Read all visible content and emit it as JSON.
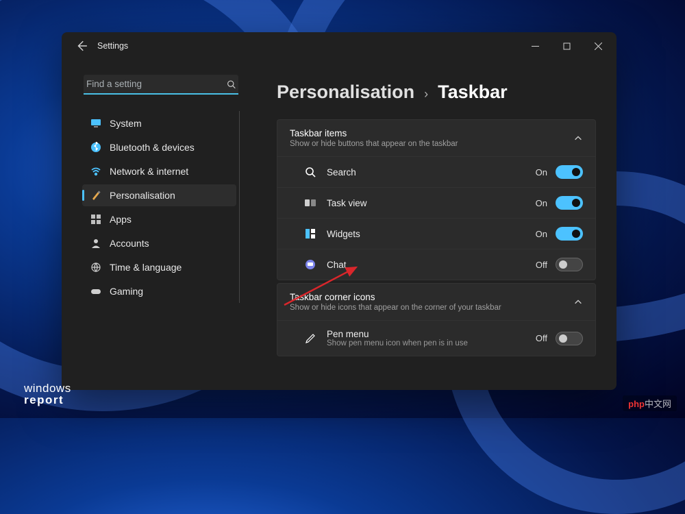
{
  "window": {
    "title": "Settings"
  },
  "search": {
    "placeholder": "Find a setting"
  },
  "sidebar": {
    "items": [
      {
        "label": "System",
        "icon": "monitor",
        "active": false
      },
      {
        "label": "Bluetooth & devices",
        "icon": "bluetooth",
        "active": false
      },
      {
        "label": "Network & internet",
        "icon": "wifi",
        "active": false
      },
      {
        "label": "Personalisation",
        "icon": "paintbrush",
        "active": true
      },
      {
        "label": "Apps",
        "icon": "apps",
        "active": false
      },
      {
        "label": "Accounts",
        "icon": "user",
        "active": false
      },
      {
        "label": "Time & language",
        "icon": "globe-clock",
        "active": false
      },
      {
        "label": "Gaming",
        "icon": "gamepad",
        "active": false
      }
    ]
  },
  "breadcrumb": {
    "parent": "Personalisation",
    "separator": "›",
    "current": "Taskbar"
  },
  "sections": [
    {
      "title": "Taskbar items",
      "subtitle": "Show or hide buttons that appear on the taskbar",
      "expanded": true,
      "rows": [
        {
          "label": "Search",
          "icon": "search",
          "state_label": "On",
          "on": true
        },
        {
          "label": "Task view",
          "icon": "taskview",
          "state_label": "On",
          "on": true
        },
        {
          "label": "Widgets",
          "icon": "widgets",
          "state_label": "On",
          "on": true
        },
        {
          "label": "Chat",
          "icon": "chat",
          "state_label": "Off",
          "on": false
        }
      ]
    },
    {
      "title": "Taskbar corner icons",
      "subtitle": "Show or hide icons that appear on the corner of your taskbar",
      "expanded": true,
      "rows": [
        {
          "label": "Pen menu",
          "sub": "Show pen menu icon when pen is in use",
          "icon": "pen",
          "state_label": "Off",
          "on": false
        }
      ]
    }
  ],
  "watermarks": {
    "left_line1": "windows",
    "left_line2": "report",
    "right_prefix": "php",
    "right_text": "中文网"
  },
  "colors": {
    "accent": "#4cc2ff",
    "window_bg": "#202020",
    "panel_bg": "#2b2b2b"
  }
}
